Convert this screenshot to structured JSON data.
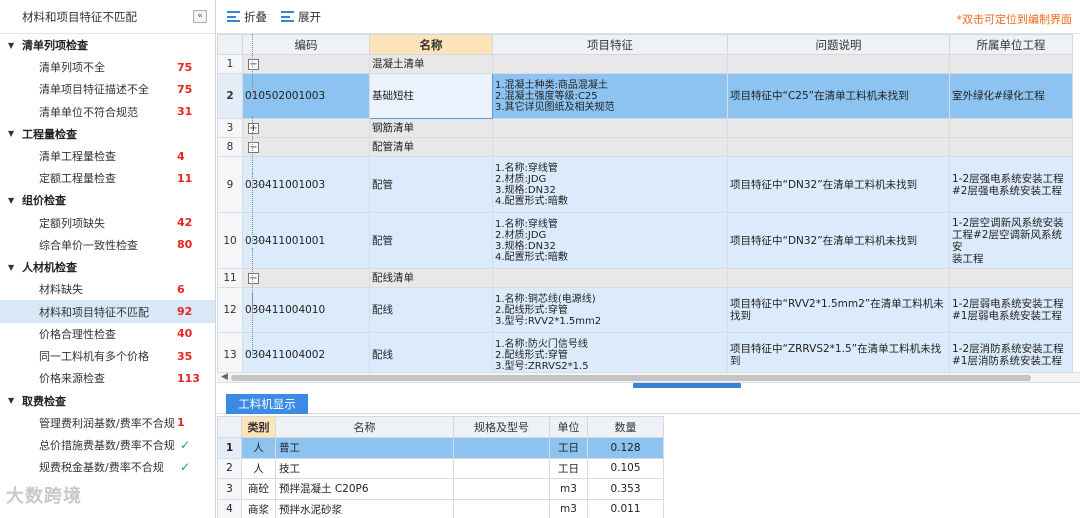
{
  "left": {
    "title": "材料和项目特征不匹配",
    "collapse_icon": "«",
    "groups": [
      {
        "label": "清单列项检查",
        "items": [
          {
            "label": "清单列项不全",
            "count": "75"
          },
          {
            "label": "清单项目特征描述不全",
            "count": "75"
          },
          {
            "label": "清单单位不符合规范",
            "count": "31"
          }
        ]
      },
      {
        "label": "工程量检查",
        "items": [
          {
            "label": "清单工程量检查",
            "count": "4"
          },
          {
            "label": "定额工程量检查",
            "count": "11"
          }
        ]
      },
      {
        "label": "组价检查",
        "items": [
          {
            "label": "定额列项缺失",
            "count": "42"
          },
          {
            "label": "综合单价一致性检查",
            "count": "80"
          }
        ]
      },
      {
        "label": "人材机检查",
        "items": [
          {
            "label": "材料缺失",
            "count": "6"
          },
          {
            "label": "材料和项目特征不匹配",
            "count": "92"
          },
          {
            "label": "价格合理性检查",
            "count": "40"
          },
          {
            "label": "同一工料机有多个价格",
            "count": "35"
          },
          {
            "label": "价格来源检查",
            "count": "113"
          }
        ]
      },
      {
        "label": "取费检查",
        "items": [
          {
            "label": "管理费利润基数/费率不合规",
            "count": "1"
          },
          {
            "label": "总价措施费基数/费率不合规",
            "count": "✓"
          },
          {
            "label": "规费税金基数/费率不合规",
            "count": "✓"
          }
        ]
      }
    ],
    "watermark": "大数跨境"
  },
  "toolbar": {
    "collapse_label": "折叠",
    "expand_label": "展开",
    "hint": "*双击可定位到编制界面"
  },
  "grid": {
    "headers": [
      "编码",
      "名称",
      "项目特征",
      "问题说明",
      "所属单位工程"
    ],
    "rows": [
      {
        "no": "1",
        "type": "group",
        "toggle": "−",
        "name": "混凝土清单"
      },
      {
        "no": "2",
        "type": "selected",
        "code": "010502001003",
        "name": "基础短柱",
        "features": [
          "1.混凝土种类:商品混凝土",
          "2.混凝土强度等级:C25",
          "3.其它详见图纸及相关规范"
        ],
        "issue": "项目特征中“C25”在清单工料机未找到",
        "unit": [
          "室外绿化#绿化工程"
        ]
      },
      {
        "no": "3",
        "type": "group",
        "toggle": "+",
        "name": "钢筋清单"
      },
      {
        "no": "8",
        "type": "group",
        "toggle": "−",
        "name": "配管清单"
      },
      {
        "no": "9",
        "type": "data",
        "code": "030411001003",
        "name": "配管",
        "features": [
          "1.名称:穿线管",
          "2.材质:JDG",
          "3.规格:DN32",
          "4.配置形式:暗敷"
        ],
        "issue": "项目特征中“DN32”在清单工料机未找到",
        "unit": [
          "1-2层强电系统安装工程",
          "#2层强电系统安装工程"
        ]
      },
      {
        "no": "10",
        "type": "data",
        "code": "030411001001",
        "name": "配管",
        "features": [
          "1.名称:穿线管",
          "2.材质:JDG",
          "3.规格:DN32",
          "4.配置形式:暗敷"
        ],
        "issue": "项目特征中“DN32”在清单工料机未找到",
        "unit": [
          "1-2层空调新风系统安装",
          "工程#2层空调新风系统安",
          "装工程"
        ]
      },
      {
        "no": "11",
        "type": "group",
        "toggle": "−",
        "name": "配线清单"
      },
      {
        "no": "12",
        "type": "data",
        "code": "030411004010",
        "name": "配线",
        "features": [
          "1.名称:铜芯线(电源线)",
          "2.配线形式:穿管",
          "3.型号:RVV2*1.5mm2"
        ],
        "issue": "项目特征中“RVV2*1.5mm2”在清单工料机未找到",
        "unit": [
          "1-2层弱电系统安装工程",
          "#1层弱电系统安装工程"
        ]
      },
      {
        "no": "13",
        "type": "data",
        "code": "030411004002",
        "name": "配线",
        "features": [
          "1.名称:防火门信号线",
          "2.配线形式:穿管",
          "3.型号:ZRRVS2*1.5"
        ],
        "issue": "项目特征中“ZRRVS2*1.5”在清单工料机未找到",
        "unit": [
          "1-2层消防系统安装工程",
          "#1层消防系统安装工程"
        ]
      }
    ]
  },
  "bottom": {
    "tab_label": "工料机显示",
    "headers": [
      "类别",
      "名称",
      "规格及型号",
      "单位",
      "数量"
    ],
    "rows": [
      {
        "no": "1",
        "cat": "人",
        "name": "普工",
        "spec": "",
        "unit": "工日",
        "qty": "0.128"
      },
      {
        "no": "2",
        "cat": "人",
        "name": "技工",
        "spec": "",
        "unit": "工日",
        "qty": "0.105"
      },
      {
        "no": "3",
        "cat": "商砼",
        "name": "预拌混凝土 C20P6",
        "spec": "",
        "unit": "m3",
        "qty": "0.353"
      },
      {
        "no": "4",
        "cat": "商浆",
        "name": "预拌水泥砂浆",
        "spec": "",
        "unit": "m3",
        "qty": "0.011"
      }
    ]
  }
}
